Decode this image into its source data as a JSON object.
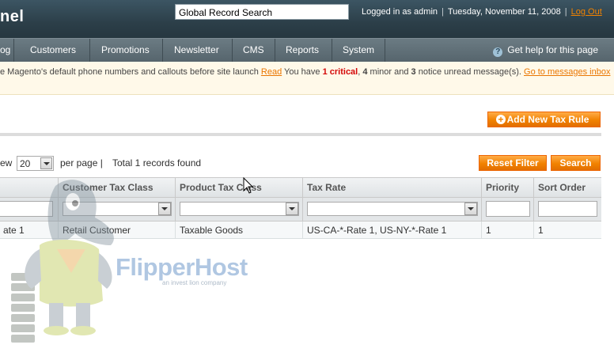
{
  "header": {
    "logo_text": "nel",
    "search_value": "Global Record Search",
    "logged_in": "Logged in as admin",
    "date": "Tuesday, November 11, 2008",
    "logout": "Log Out"
  },
  "nav": {
    "items": [
      "og",
      "Customers",
      "Promotions",
      "Newsletter",
      "CMS",
      "Reports",
      "System"
    ],
    "help": "Get help for this page"
  },
  "notice": {
    "pre": "e Magento's default phone numbers and callouts before site launch",
    "read_link": "Read",
    "msg_1": "You have",
    "critical": "1 critical",
    "msg_2": ",",
    "minor": "4",
    "msg_3": "minor and",
    "notice_count": "3",
    "msg_4": "notice unread message(s).",
    "inbox_link": "Go to messages inbox"
  },
  "page": {
    "add_button": "Add New Tax Rule"
  },
  "pager": {
    "view_prefix": "ew",
    "per_page_value": "20",
    "per_page_label": "per page |",
    "total": "Total 1 records found",
    "reset_filter": "Reset Filter",
    "search": "Search"
  },
  "grid": {
    "columns": [
      "",
      "Customer Tax Class",
      "Product Tax Class",
      "Tax Rate",
      "Priority",
      "Sort Order"
    ],
    "rows": [
      [
        "ate 1",
        "Retail Customer",
        "Taxable Goods",
        "US-CA-*-Rate 1, US-NY-*-Rate 1",
        "1",
        "1"
      ]
    ]
  },
  "watermark": {
    "brand": "FlipperHost",
    "tagline": "an invest lion company"
  },
  "colors": {
    "accent": "#f18200",
    "header_bg": "#2c3f49",
    "nav_bg": "#5f6e76"
  }
}
